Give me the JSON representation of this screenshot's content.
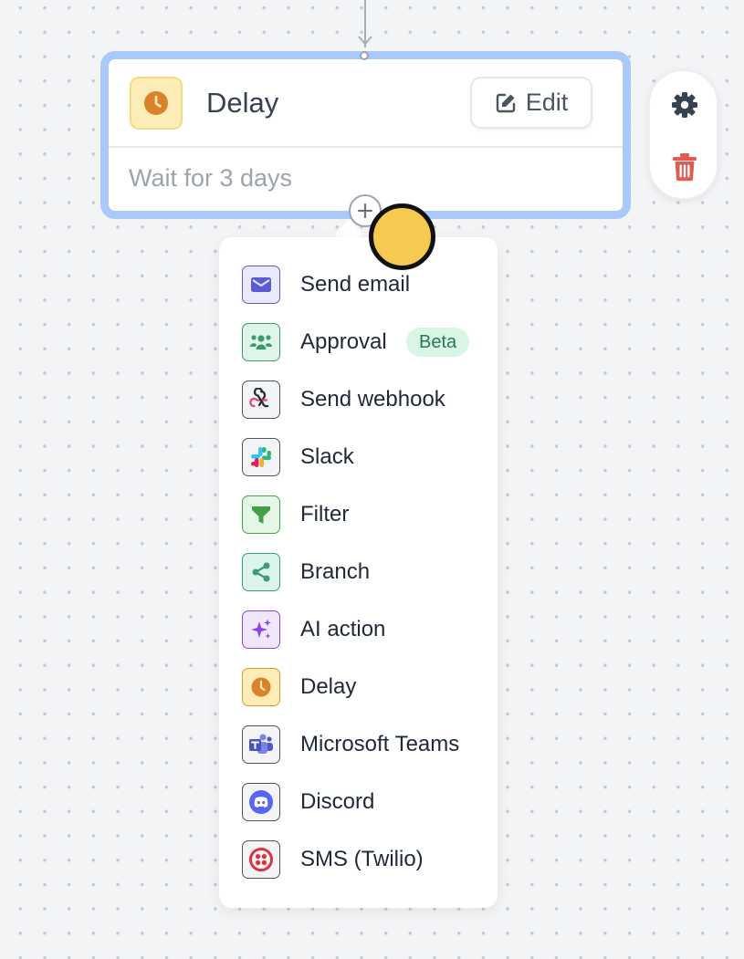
{
  "node": {
    "title": "Delay",
    "subtitle": "Wait for 3 days",
    "edit_label": "Edit",
    "icon": "clock-icon"
  },
  "toolbar": {
    "settings_icon": "gear-icon",
    "delete_icon": "trash-icon"
  },
  "menu": {
    "items": [
      {
        "label": "Send email",
        "icon": "envelope-icon",
        "icon_bg": "#e9e8fd",
        "icon_border": "#5b5bd6"
      },
      {
        "label": "Approval",
        "icon": "users-icon",
        "badge": "Beta",
        "icon_bg": "#e0f5ea",
        "icon_border": "#3c9a6a"
      },
      {
        "label": "Send webhook",
        "icon": "webhook-icon",
        "icon_bg": "#f3f4f6",
        "icon_border": "#4b5563"
      },
      {
        "label": "Slack",
        "icon": "slack-icon",
        "icon_bg": "#f3f4f6",
        "icon_border": "#4b5563"
      },
      {
        "label": "Filter",
        "icon": "funnel-icon",
        "icon_bg": "#e4f6e6",
        "icon_border": "#43a047"
      },
      {
        "label": "Branch",
        "icon": "share-icon",
        "icon_bg": "#ddf4ec",
        "icon_border": "#3b9b7a"
      },
      {
        "label": "AI action",
        "icon": "sparkles-icon",
        "icon_bg": "#f1e7fd",
        "icon_border": "#8b45e6"
      },
      {
        "label": "Delay",
        "icon": "clock-icon",
        "icon_bg": "#fcecb6",
        "icon_border": "#d99a2a"
      },
      {
        "label": "Microsoft Teams",
        "icon": "teams-icon",
        "icon_bg": "#f3f4f6",
        "icon_border": "#4b5563"
      },
      {
        "label": "Discord",
        "icon": "discord-icon",
        "icon_bg": "#f3f4f6",
        "icon_border": "#4b5563"
      },
      {
        "label": "SMS (Twilio)",
        "icon": "twilio-icon",
        "icon_bg": "#f3f4f6",
        "icon_border": "#4b5563"
      }
    ]
  },
  "colors": {
    "selection_border": "#a9c9fb",
    "delay_accent": "#d9822b",
    "delete_red": "#e05b52",
    "cursor_fill": "#f6c94f"
  }
}
